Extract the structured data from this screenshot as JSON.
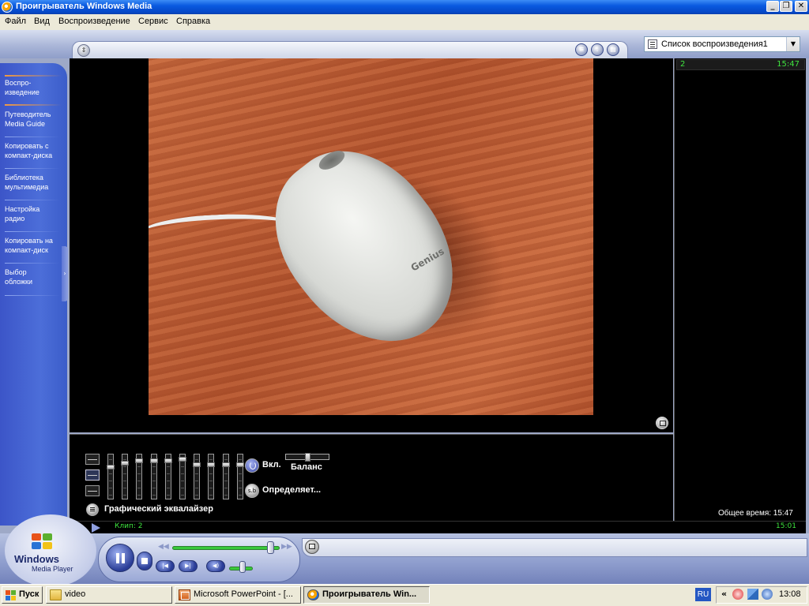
{
  "window": {
    "title": "Проигрыватель Windows Media",
    "minimize_glyph": "_",
    "maximize_glyph": "❐",
    "close_glyph": "✕"
  },
  "menu": [
    {
      "label": "Файл"
    },
    {
      "label": "Вид"
    },
    {
      "label": "Воспроизведение"
    },
    {
      "label": "Сервис"
    },
    {
      "label": "Справка"
    }
  ],
  "playlist_selector": {
    "value": "Список воспроизведения1",
    "icon": "playlist-icon"
  },
  "nav": [
    {
      "line1": "Воспро-",
      "line2": "изведение",
      "active": true
    },
    {
      "line1": "Путеводитель",
      "line2": "Media Guide",
      "active": false
    },
    {
      "line1": "Копировать с",
      "line2": "компакт-диска",
      "active": false
    },
    {
      "line1": "Библиотека",
      "line2": "мультимедиа",
      "active": false
    },
    {
      "line1": "Настройка",
      "line2": "радио",
      "active": false
    },
    {
      "line1": "Копировать на",
      "line2": "компакт-диск",
      "active": false
    },
    {
      "line1": "Выбор",
      "line2": "обложки",
      "active": false
    }
  ],
  "video": {
    "overlay_text": "Genius"
  },
  "playlist": {
    "rows": [
      {
        "index": "2",
        "duration": "15:47"
      }
    ],
    "total_time": "Общее время: 15:47"
  },
  "equalizer": {
    "bands": [
      0.75,
      0.85,
      0.9,
      0.9,
      0.9,
      0.95,
      0.8,
      0.8,
      0.8,
      0.8
    ],
    "power_label": "Вкл.",
    "mode_label": "Определяет...",
    "mode_icon_text": "s.b",
    "balance_label": "Баланс",
    "balance_value": 0.5,
    "title": "Графический эквалайзер"
  },
  "status": {
    "clip": "Клип: 2",
    "elapsed": "15:01"
  },
  "controls": {
    "seek_value": 0.91,
    "volume_value": 0.55,
    "rewind_glyph": "◀◀",
    "forward_glyph": "▶▶",
    "prev_glyph": "|◀",
    "next_glyph": "▶|",
    "mute_glyph": "◀)"
  },
  "logo": {
    "line1": "Windows",
    "line2": "Media Player"
  },
  "taskbar": {
    "start_label": "Пуск",
    "items": [
      {
        "label": "video",
        "active": false
      },
      {
        "label": "Microsoft PowerPoint - [...",
        "active": false
      },
      {
        "label": "Проигрыватель Win...",
        "active": true
      }
    ],
    "lang": "RU",
    "tray_arrow": "«",
    "clock": "13:08"
  }
}
